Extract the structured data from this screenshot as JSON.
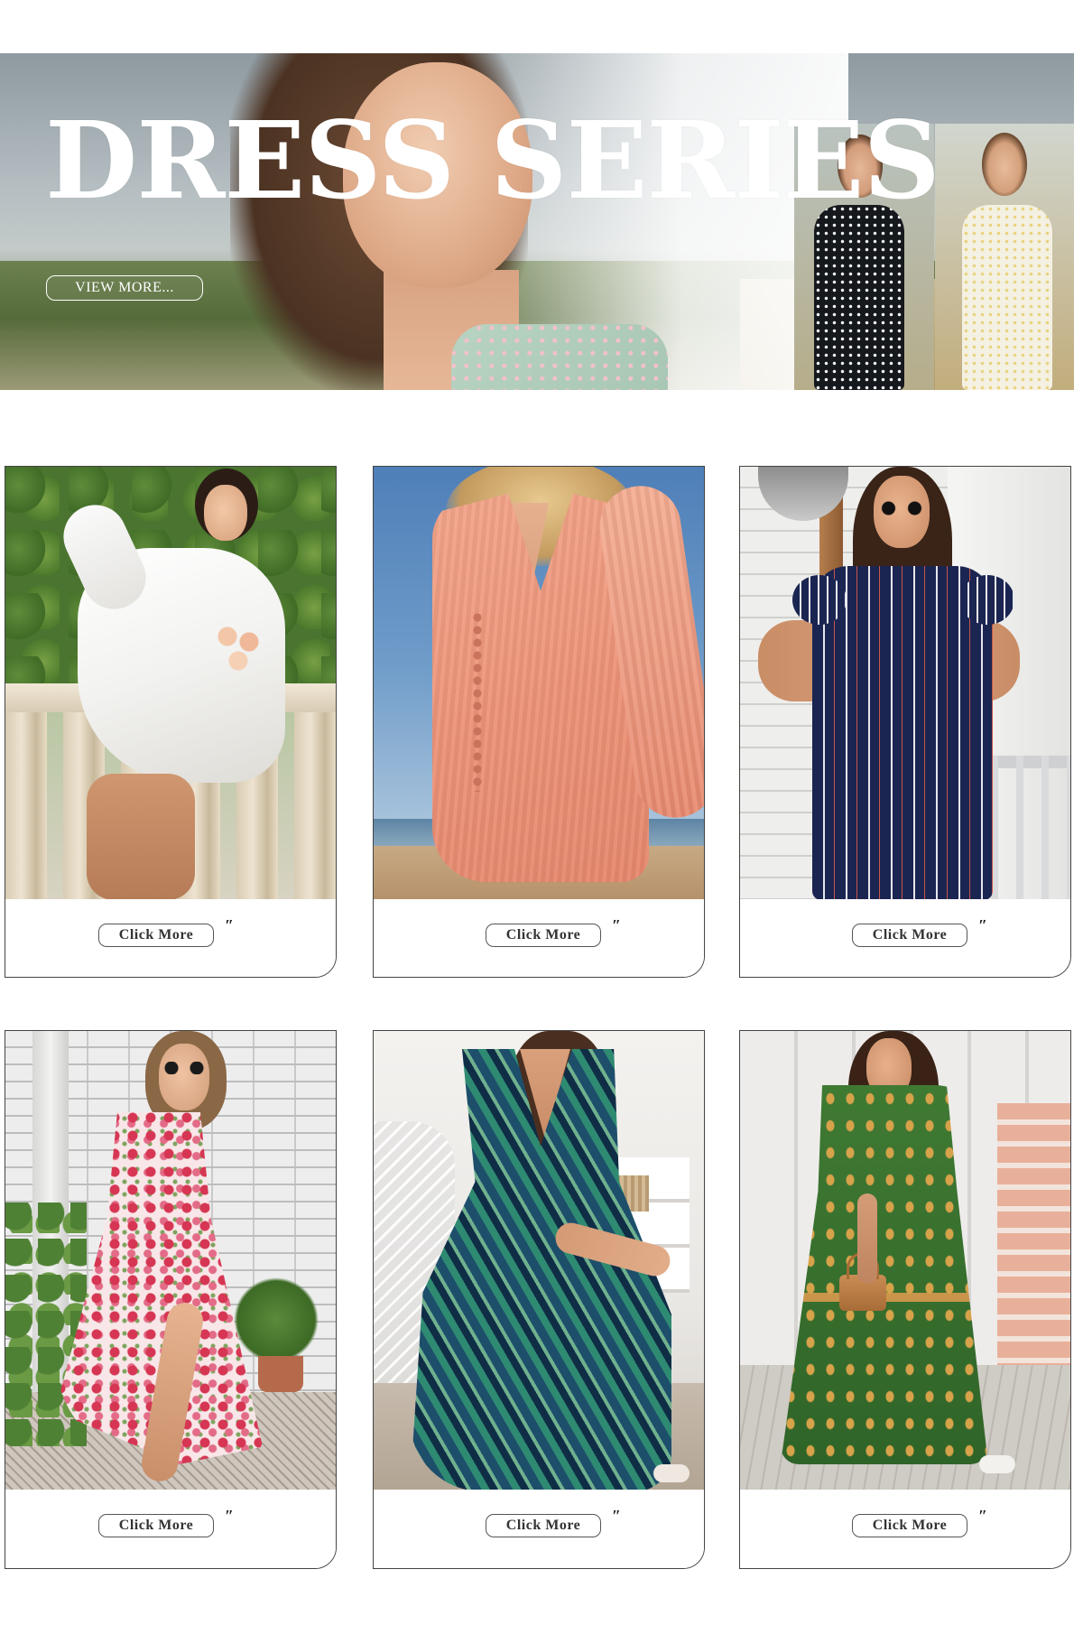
{
  "banner": {
    "title": "DRESS SERIES",
    "button_label": "VIEW MORE..."
  },
  "products": [
    {
      "button_label": "Click More",
      "quote_mark": "″",
      "dress_color": "white"
    },
    {
      "button_label": "Click More",
      "quote_mark": "″",
      "dress_color": "peach"
    },
    {
      "button_label": "Click More",
      "quote_mark": "″",
      "dress_color": "navy striped"
    },
    {
      "button_label": "Click More",
      "quote_mark": "″",
      "dress_color": "pink floral"
    },
    {
      "button_label": "Click More",
      "quote_mark": "″",
      "dress_color": "green palm print"
    },
    {
      "button_label": "Click More",
      "quote_mark": "″",
      "dress_color": "green printed"
    }
  ],
  "colors": {
    "card_border": "#444444",
    "button_text": "#333333",
    "banner_text": "#ffffff"
  }
}
